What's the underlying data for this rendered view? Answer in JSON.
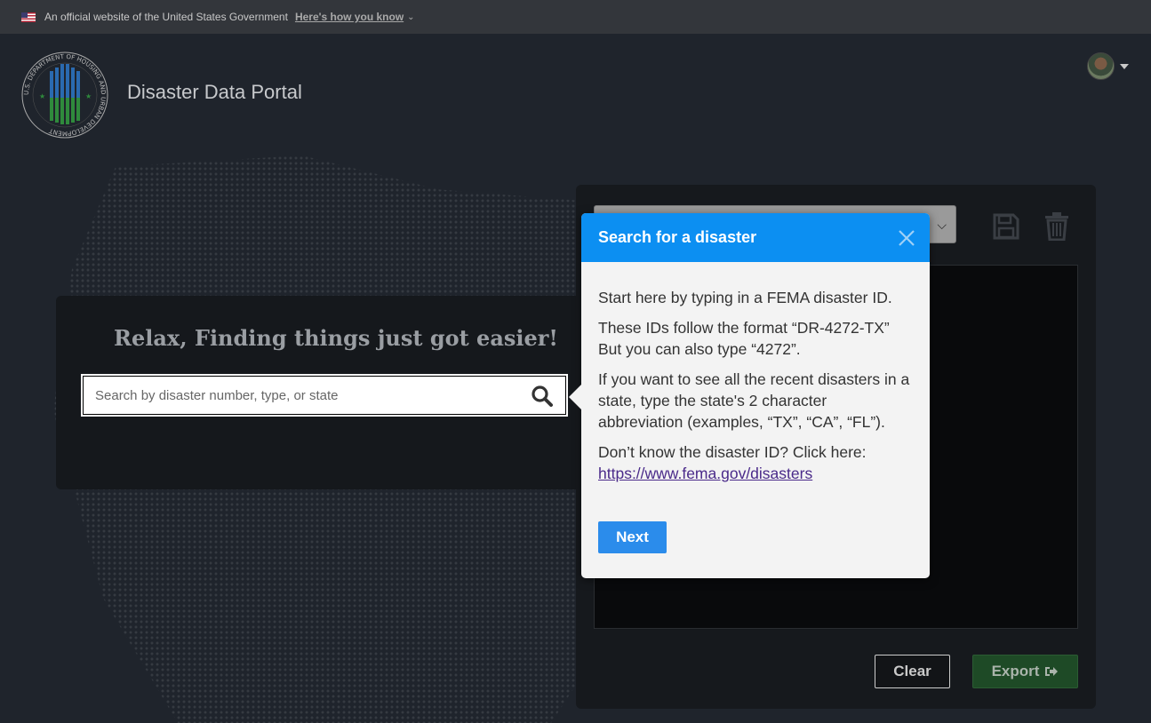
{
  "gov_banner": {
    "text": "An official website of the United States Government",
    "link": "Here's how you know"
  },
  "header": {
    "app_title": "Disaster Data Portal",
    "seal_text": "U.S. DEPARTMENT OF HOUSING AND URBAN DEVELOPMENT"
  },
  "search": {
    "heading": "Relax, Finding things just got easier!",
    "placeholder": "Search by disaster number, type, or state"
  },
  "actions": {
    "clear_label": "Clear",
    "export_label": "Export"
  },
  "popover": {
    "title": "Search for a disaster",
    "p1": "Start here by typing in a FEMA disaster ID.",
    "p2": "These IDs follow the format “DR-4272-TX” But you can also type “4272”.",
    "p3": "If you want to see all the recent disasters in a state, type the state's 2 character abbreviation (examples, “TX”, “CA”, “FL”).",
    "p4": "Don’t know the disaster ID? Click here:",
    "link": "https://www.fema.gov/disasters",
    "next_label": "Next"
  },
  "colors": {
    "popover_header": "#0c8ff2",
    "next_button": "#2b8ceb",
    "export_button": "#1e4a26"
  }
}
